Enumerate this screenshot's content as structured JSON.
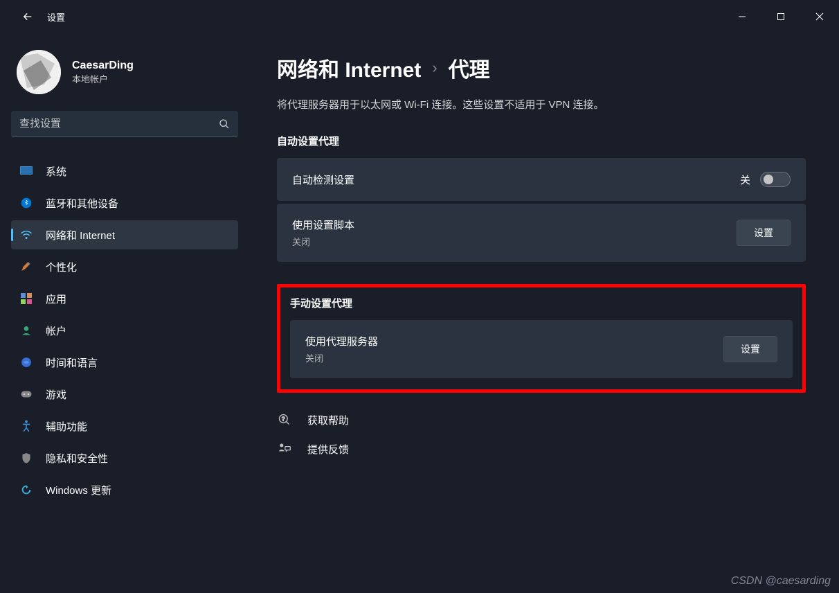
{
  "titlebar": {
    "app_title": "设置"
  },
  "profile": {
    "username": "CaesarDing",
    "account_type": "本地帐户"
  },
  "search": {
    "placeholder": "查找设置"
  },
  "nav": [
    {
      "icon": "system-icon",
      "label": "系统"
    },
    {
      "icon": "bluetooth-icon",
      "label": "蓝牙和其他设备"
    },
    {
      "icon": "wifi-icon",
      "label": "网络和 Internet"
    },
    {
      "icon": "personalize-icon",
      "label": "个性化"
    },
    {
      "icon": "apps-icon",
      "label": "应用"
    },
    {
      "icon": "account-icon",
      "label": "帐户"
    },
    {
      "icon": "time-icon",
      "label": "时间和语言"
    },
    {
      "icon": "gaming-icon",
      "label": "游戏"
    },
    {
      "icon": "accessibility-icon",
      "label": "辅助功能"
    },
    {
      "icon": "privacy-icon",
      "label": "隐私和安全性"
    },
    {
      "icon": "update-icon",
      "label": "Windows 更新"
    }
  ],
  "breadcrumb": {
    "parent": "网络和 Internet",
    "current": "代理"
  },
  "description": "将代理服务器用于以太网或 Wi-Fi 连接。这些设置不适用于 VPN 连接。",
  "section_auto": {
    "header": "自动设置代理",
    "card1": {
      "title": "自动检测设置",
      "toggle_label": "关"
    },
    "card2": {
      "title": "使用设置脚本",
      "sub": "关闭",
      "button": "设置"
    }
  },
  "section_manual": {
    "header": "手动设置代理",
    "card": {
      "title": "使用代理服务器",
      "sub": "关闭",
      "button": "设置"
    }
  },
  "help": {
    "get_help": "获取帮助",
    "feedback": "提供反馈"
  },
  "watermark": "CSDN @caesarding"
}
